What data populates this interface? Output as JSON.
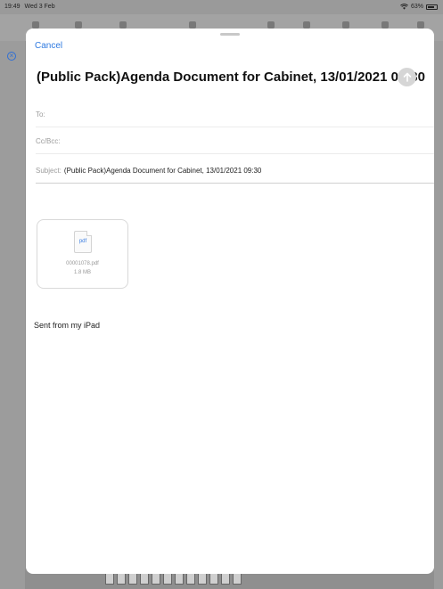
{
  "status_bar": {
    "time": "19:49",
    "date": "Wed 3 Feb",
    "battery": "63%",
    "icons": [
      "wifi-icon",
      "battery-icon"
    ]
  },
  "compose": {
    "cancel_label": "Cancel",
    "title": "(Public Pack)Agenda Document for Cabinet, 13/01/2021 09:30",
    "to_label": "To:",
    "to_value": "",
    "cc_label": "Cc/Bcc:",
    "cc_value": "",
    "subject_label": "Subject:",
    "subject_value": "(Public Pack)Agenda Document for Cabinet, 13/01/2021 09:30",
    "attachment": {
      "type_label": "pdf",
      "filename": "00001078.pdf",
      "size": "1.8 MB"
    },
    "body_text": "Sent from my iPad",
    "send_icon": "arrow-up-icon"
  },
  "colors": {
    "accent": "#2f7ae0",
    "send_disabled": "#d6d6d6"
  }
}
